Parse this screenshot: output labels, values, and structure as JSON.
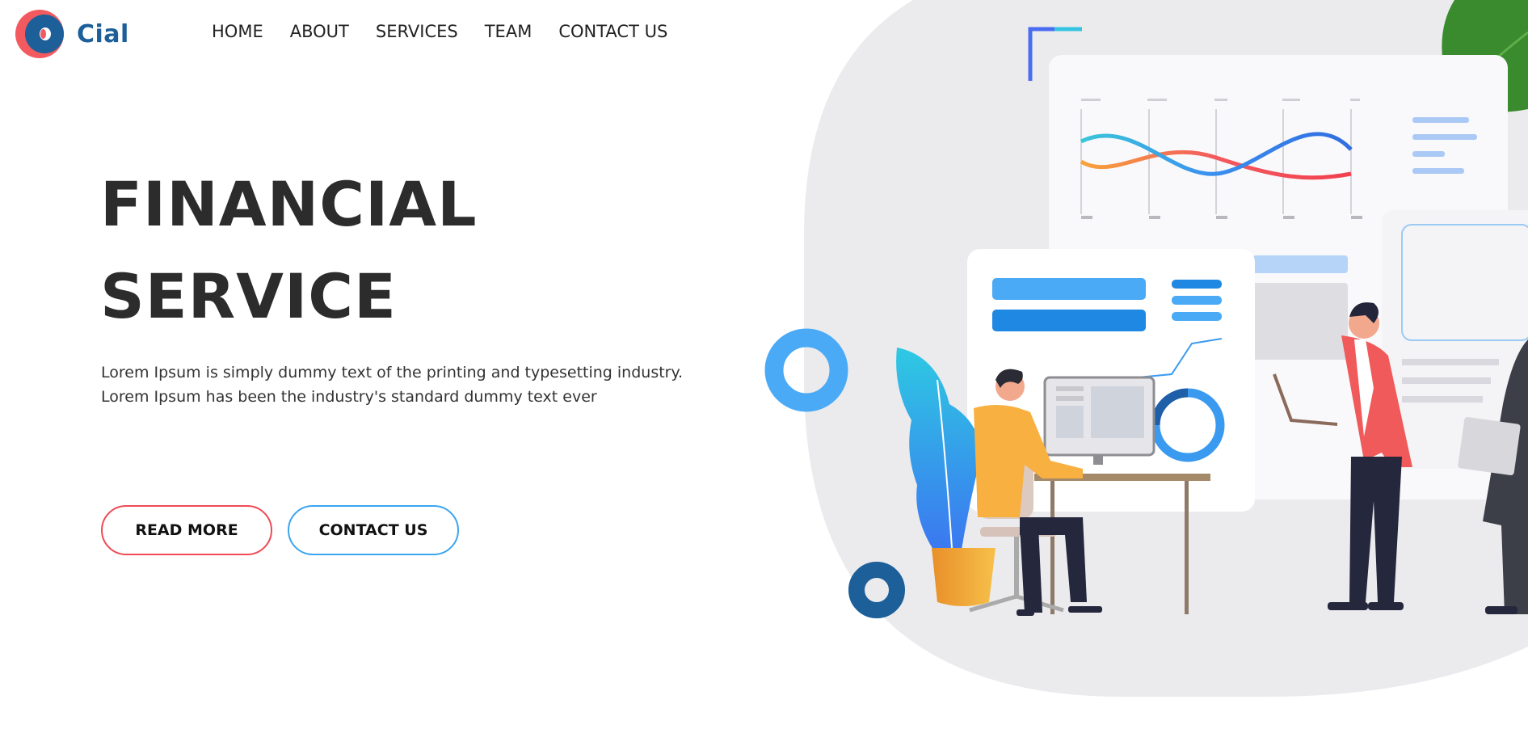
{
  "brand": {
    "name": "Cial"
  },
  "nav": {
    "items": [
      "HOME",
      "ABOUT",
      "SERVICES",
      "TEAM",
      "CONTACT US"
    ]
  },
  "hero": {
    "title_line1": "FINANCIAL",
    "title_line2": "SERVICE",
    "text_line1": "Lorem Ipsum is simply dummy text of the printing and typesetting industry.",
    "text_line2": "Lorem Ipsum has been the industry's standard dummy text ever"
  },
  "buttons": {
    "read_more": "READ MORE",
    "contact_us": "CONTACT US"
  },
  "colors": {
    "brand_blue": "#1c5f99",
    "brand_red": "#f25a5f",
    "accent_blue": "#46a8f5",
    "text_dark": "#2c2c2c",
    "blob_gray": "#ebebee"
  },
  "icons": [
    "logo-mark-icon",
    "ring-icon",
    "plant-icon",
    "chart-icon"
  ]
}
